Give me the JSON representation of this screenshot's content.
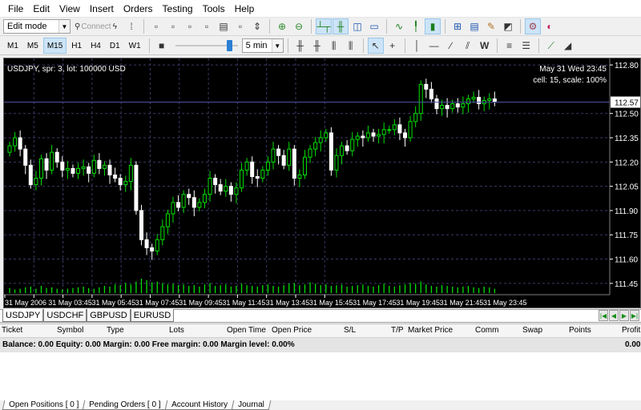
{
  "menu": [
    "File",
    "Edit",
    "View",
    "Insert",
    "Orders",
    "Testing",
    "Tools",
    "Help"
  ],
  "toolbar": {
    "mode_select": "Edit mode",
    "connect_label": "Connect",
    "timeframes": [
      "M1",
      "M5",
      "M15",
      "H1",
      "H4",
      "D1",
      "W1"
    ],
    "active_timeframe": "M15",
    "speed_select": "5 min",
    "speed_slider_level": 0.9
  },
  "chart": {
    "info_left": "USDJPY, spr: 3, lot: 100000 USD",
    "info_right_1": "May 31 Wed 23:45",
    "info_right_2": "cell: 15, scale: 100%",
    "current_price": "112.57",
    "colors": {
      "background": "#000000",
      "bull": "#00e000",
      "bear": "#ffffff",
      "grid": "#3a3a66",
      "axis_text": "#ffffff"
    },
    "price_ticks": [
      "112.80",
      "112.50",
      "112.35",
      "112.20",
      "112.05",
      "111.90",
      "111.75",
      "111.60",
      "111.45"
    ],
    "time_ticks": [
      "31 May 2006",
      "31 May 03:45",
      "31 May 05:45",
      "31 May 07:45",
      "31 May 09:45",
      "31 May 11:45",
      "31 May 13:45",
      "31 May 15:45",
      "31 May 17:45",
      "31 May 19:45",
      "31 May 21:45",
      "31 May 23:45"
    ]
  },
  "chart_data": {
    "type": "candlestick",
    "symbol": "USDJPY",
    "timeframe": "M15",
    "ylim": [
      111.38,
      112.84
    ],
    "closes": [
      112.3,
      112.35,
      112.28,
      112.18,
      112.06,
      112.1,
      112.22,
      112.15,
      112.26,
      112.2,
      112.15,
      112.16,
      112.13,
      112.16,
      112.17,
      112.13,
      112.21,
      112.16,
      112.18,
      112.12,
      112.1,
      112.06,
      112.08,
      112.18,
      111.9,
      111.72,
      111.67,
      111.65,
      111.72,
      111.8,
      111.88,
      111.95,
      111.92,
      112.0,
      111.98,
      111.92,
      111.95,
      112.0,
      112.1,
      112.06,
      112.02,
      112.05,
      112.0,
      112.04,
      112.15,
      112.2,
      112.11,
      112.1,
      112.15,
      112.2,
      112.28,
      112.24,
      112.18,
      112.28,
      112.1,
      112.12,
      112.23,
      112.28,
      112.32,
      112.35,
      112.38,
      112.15,
      112.24,
      112.3,
      112.27,
      112.34,
      112.36,
      112.35,
      112.38,
      112.36,
      112.37,
      112.4,
      112.4,
      112.43,
      112.38,
      112.35,
      112.45,
      112.5,
      112.68,
      112.65,
      112.59,
      112.53,
      112.55,
      112.53,
      112.56,
      112.54,
      112.56,
      112.59,
      112.6,
      112.56,
      112.58,
      112.59,
      112.57
    ],
    "volume_relative": [
      0.35,
      0.25,
      0.3,
      0.4,
      0.45,
      0.3,
      0.5,
      0.35,
      0.4,
      0.3,
      0.25,
      0.3,
      0.35,
      0.4,
      0.45,
      0.35,
      0.3,
      0.4,
      0.5,
      0.45,
      0.6,
      0.55,
      0.7,
      0.6,
      0.8,
      1.0,
      0.9,
      0.75,
      0.8,
      0.7,
      0.6,
      0.65,
      0.55,
      0.6,
      0.5,
      0.55,
      0.45,
      0.6,
      0.7,
      0.5,
      0.55,
      0.6,
      0.45,
      0.5,
      0.65,
      0.55,
      0.5,
      0.45,
      0.55,
      0.6,
      0.5,
      0.45,
      0.55,
      0.65,
      0.7,
      0.55,
      0.6,
      0.75,
      0.65,
      0.55,
      0.6,
      0.5,
      0.55,
      0.6,
      0.45,
      0.5,
      0.55,
      0.6,
      0.5,
      0.45,
      0.55,
      0.65,
      0.5,
      0.45,
      0.55,
      0.6,
      0.7,
      0.65,
      0.8,
      0.6,
      0.5,
      0.45,
      0.55,
      0.5,
      0.45,
      0.4,
      0.45,
      0.5,
      0.4,
      0.35,
      0.45,
      0.4,
      0.3
    ]
  },
  "chart_tabs": [
    "USDJPY",
    "USDCHF",
    "GBPUSD",
    "EURUSD"
  ],
  "active_chart_tab": "USDJPY",
  "terminal": {
    "columns": [
      "Ticket",
      "Symbol",
      "Type",
      "Lots",
      "Open Time",
      "Open Price",
      "S/L",
      "T/P",
      "Market Price",
      "Comm",
      "Swap",
      "Points",
      "Profit"
    ],
    "balance_line": "Balance: 0.00 Equity: 0.00 Margin: 0.00 Free margin: 0.00 Margin level: 0.00%",
    "balance_profit": "0.00"
  },
  "bottom_tabs": [
    "Open Positions [ 0 ]",
    "Pending Orders [ 0 ]",
    "Account History",
    "Journal"
  ],
  "active_bottom_tab": "Open Positions [ 0 ]"
}
